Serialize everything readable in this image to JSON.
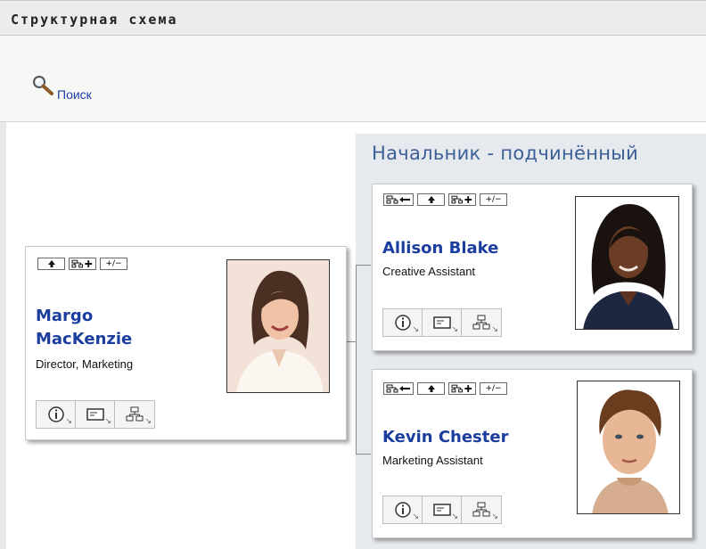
{
  "header": {
    "title": "Структурная схема"
  },
  "toolbar": {
    "search_label": "Поиск"
  },
  "panel": {
    "title": "Начальник - подчинённый"
  },
  "cards": {
    "manager": {
      "first_name": "Margo",
      "last_name": "MacKenzie",
      "title": "Director, Marketing",
      "nav": {
        "up": "🠕",
        "add": "品+",
        "toggle": "+/−"
      }
    },
    "report1": {
      "name": "Allison Blake",
      "title": "Creative Assistant",
      "nav": {
        "back": "品←",
        "up": "🠕",
        "add": "品+",
        "toggle": "+/−"
      }
    },
    "report2": {
      "name": "Kevin Chester",
      "title": "Marketing Assistant",
      "nav": {
        "back": "品←",
        "up": "🠕",
        "add": "品+",
        "toggle": "+/−"
      }
    }
  },
  "icons": {
    "search": "magnifier-icon",
    "info": "info-icon",
    "card": "id-card-icon",
    "org": "org-chart-icon"
  }
}
